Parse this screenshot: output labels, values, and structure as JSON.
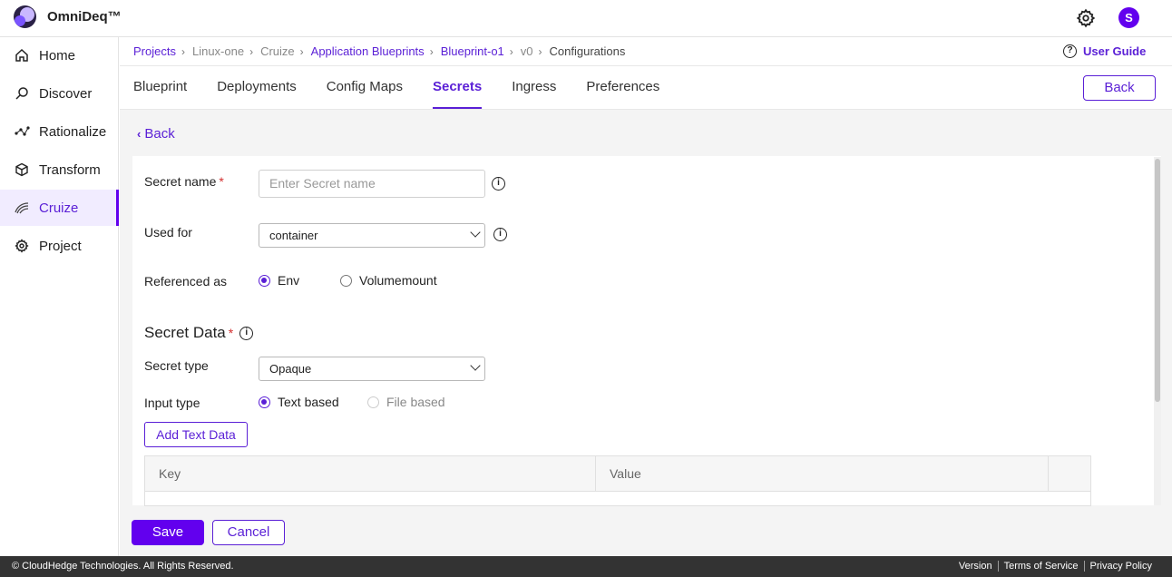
{
  "app": {
    "brand": "OmniDeq™",
    "avatar_initial": "S"
  },
  "sidebar": {
    "items": [
      {
        "label": "Home",
        "icon": "home-icon"
      },
      {
        "label": "Discover",
        "icon": "discover-icon"
      },
      {
        "label": "Rationalize",
        "icon": "rationalize-icon"
      },
      {
        "label": "Transform",
        "icon": "cube-icon"
      },
      {
        "label": "Cruize",
        "icon": "cruize-icon",
        "active": true
      },
      {
        "label": "Project",
        "icon": "gear-icon"
      }
    ]
  },
  "breadcrumb": {
    "items": [
      "Projects",
      "Linux-one",
      "Cruize",
      "Application Blueprints",
      "Blueprint-o1",
      "v0",
      "Configurations"
    ]
  },
  "user_guide": "User Guide",
  "tabs": [
    "Blueprint",
    "Deployments",
    "Config Maps",
    "Secrets",
    "Ingress",
    "Preferences"
  ],
  "active_tab": "Secrets",
  "back_button": "Back",
  "back_link": "Back",
  "form": {
    "secret_name_label": "Secret name",
    "secret_name_placeholder": "Enter  Secret name",
    "used_for_label": "Used for",
    "used_for_value": "container",
    "referenced_as_label": "Referenced as",
    "referenced_options": [
      "Env",
      "Volumemount"
    ],
    "referenced_selected": "Env",
    "secret_data_title": "Secret Data",
    "secret_type_label": "Secret type",
    "secret_type_value": "Opaque",
    "input_type_label": "Input type",
    "input_type_options": [
      "Text based",
      "File based"
    ],
    "input_type_selected": "Text based",
    "add_text_data": "Add Text Data",
    "table_headers": [
      "Key",
      "Value"
    ],
    "required_marker": "*",
    "info_glyph": "i"
  },
  "actions": {
    "save": "Save",
    "cancel": "Cancel"
  },
  "footer": {
    "copyright": "© CloudHedge Technologies. All Rights Reserved.",
    "links": [
      "Version",
      "Terms of Service",
      "Privacy Policy"
    ]
  },
  "colors": {
    "accent": "#6200ee",
    "link": "#5a1fd6",
    "required": "#d32f2f",
    "footer_bg": "#333333"
  }
}
